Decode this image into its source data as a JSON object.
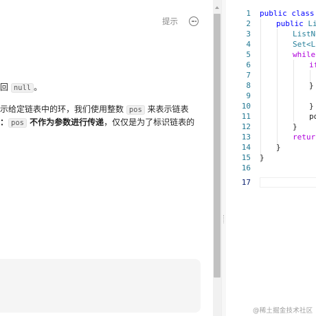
{
  "description": {
    "hint_label": "提示",
    "line1": {
      "t1": "返回 ",
      "code1": "null",
      "t2": "。"
    },
    "line2": {
      "t1": "表示给定链表中的环，我们使用整数 ",
      "code1": "pos",
      "t2": " 来表示链表"
    },
    "line3": {
      "bold1": "意：",
      "code1": "pos",
      "bold2": " 不作为参数进行传递",
      "t2": "，仅仅是为了标识链表的"
    }
  },
  "editor": {
    "line_numbers": [
      "1",
      "2",
      "3",
      "4",
      "5",
      "6",
      "7",
      "8",
      "9",
      "10",
      "11",
      "12",
      "13",
      "14",
      "15",
      "16",
      "17"
    ],
    "active_line": "17",
    "code": {
      "l1": {
        "kw1": "public",
        "kw2": "class",
        "rest": "S"
      },
      "l2": {
        "kw1": "public",
        "ty": "Lis"
      },
      "l3": {
        "ty": "ListNo"
      },
      "l4": {
        "ty": "Set<Li"
      },
      "l5": {
        "kw": "while"
      },
      "l6": {
        "kw": "if"
      },
      "l8": {
        "brace": "}"
      },
      "l10": {
        "brace": "}"
      },
      "l11": {
        "text": "po"
      },
      "l12": {
        "brace": "}"
      },
      "l13": {
        "kw": "return"
      },
      "l14": {
        "brace": "}"
      },
      "l15": {
        "brace": "}"
      }
    }
  },
  "watermark": "@稀土掘金技术社区"
}
